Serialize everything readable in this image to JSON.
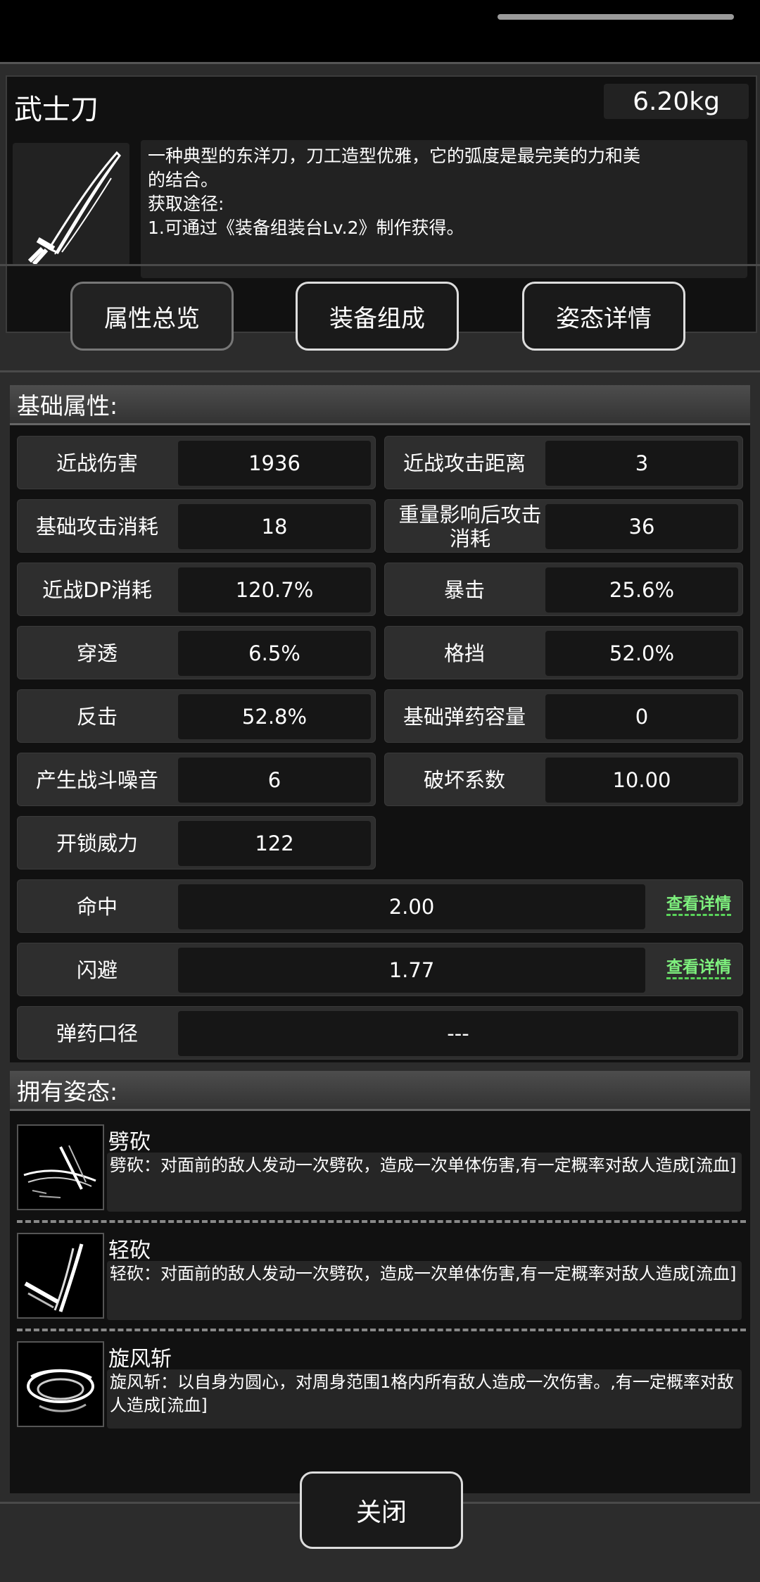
{
  "item": {
    "name": "武士刀",
    "weight": "6.20kg",
    "description": [
      "一种典型的东洋刀，刀工造型优雅，它的弧度是最完美的力和美",
      "的结合。",
      "获取途径:",
      "1.可通过《装备组装台Lv.2》制作获得。"
    ]
  },
  "tabs": [
    {
      "label": "属性总览"
    },
    {
      "label": "装备组成"
    },
    {
      "label": "姿态详情"
    }
  ],
  "base": {
    "title": "基础属性:",
    "stats": [
      {
        "label": "近战伤害",
        "value": "1936"
      },
      {
        "label": "近战攻击距离",
        "value": "3"
      },
      {
        "label": "基础攻击消耗",
        "value": "18"
      },
      {
        "label": "重量影响后攻击消耗",
        "value": "36"
      },
      {
        "label": "近战DP消耗",
        "value": "120.7%"
      },
      {
        "label": "暴击",
        "value": "25.6%"
      },
      {
        "label": "穿透",
        "value": "6.5%"
      },
      {
        "label": "格挡",
        "value": "52.0%"
      },
      {
        "label": "反击",
        "value": "52.8%"
      },
      {
        "label": "基础弹药容量",
        "value": "0"
      },
      {
        "label": "产生战斗噪音",
        "value": "6"
      },
      {
        "label": "破坏系数",
        "value": "10.00"
      },
      {
        "label": "开锁威力",
        "value": "122"
      }
    ],
    "wide": [
      {
        "label": "命中",
        "value": "2.00",
        "link": "查看详情"
      },
      {
        "label": "闪避",
        "value": "1.77",
        "link": "查看详情"
      },
      {
        "label": "弹药口径",
        "value": "---"
      }
    ]
  },
  "stances": {
    "title": "拥有姿态:",
    "items": [
      {
        "name": "劈砍",
        "desc": "劈砍：对面前的敌人发动一次劈砍，造成一次单体伤害,有一定概率对敌人造成[流血]",
        "icon": "slash-icon"
      },
      {
        "name": "轻砍",
        "desc": "轻砍：对面前的敌人发动一次劈砍，造成一次单体伤害,有一定概率对敌人造成[流血]",
        "icon": "light-slash-icon"
      },
      {
        "name": "旋风斩",
        "desc": "旋风斩：以自身为圆心，对周身范围1格内所有敌人造成一次伤害。,有一定概率对敌人造成[流血]",
        "icon": "whirlwind-icon"
      }
    ]
  },
  "close_label": "关闭"
}
